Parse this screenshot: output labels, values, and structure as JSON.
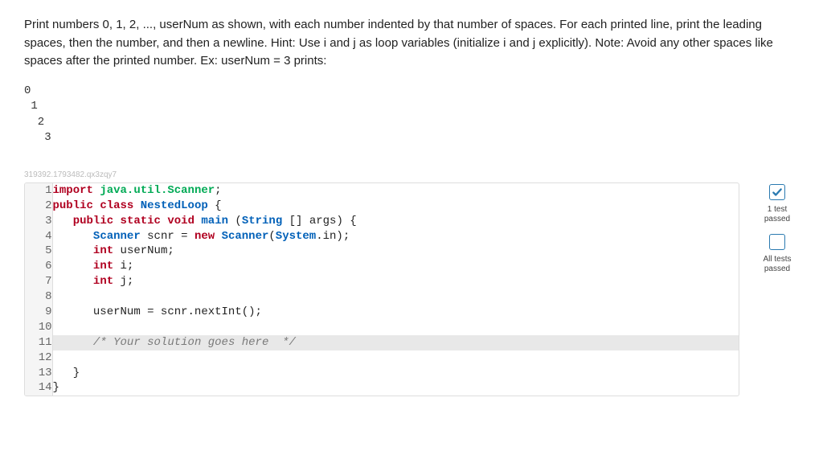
{
  "problem": {
    "description": "Print numbers 0, 1, 2, ..., userNum as shown, with each number indented by that number of spaces. For each printed line, print the leading spaces, then the number, and then a newline. Hint: Use i and j as loop variables (initialize i and j explicitly). Note: Avoid any other spaces like spaces after the printed number. Ex: userNum = 3 prints:",
    "example_output": "0\n 1\n  2\n   3"
  },
  "tracking_id": "319392.1793482.qx3zqy7",
  "code": {
    "lines": [
      {
        "n": "1",
        "segs": [
          {
            "c": "kw-import",
            "t": "import"
          },
          {
            "c": "plain",
            "t": " "
          },
          {
            "c": "kw-pkg",
            "t": "java.util.Scanner"
          },
          {
            "c": "plain",
            "t": ";"
          }
        ]
      },
      {
        "n": "2",
        "segs": [
          {
            "c": "kw-mod",
            "t": "public"
          },
          {
            "c": "plain",
            "t": " "
          },
          {
            "c": "kw-cls",
            "t": "class"
          },
          {
            "c": "plain",
            "t": " "
          },
          {
            "c": "cls-name",
            "t": "NestedLoop"
          },
          {
            "c": "plain",
            "t": " {"
          }
        ]
      },
      {
        "n": "3",
        "segs": [
          {
            "c": "plain",
            "t": "   "
          },
          {
            "c": "kw-mod",
            "t": "public"
          },
          {
            "c": "plain",
            "t": " "
          },
          {
            "c": "kw-mod",
            "t": "static"
          },
          {
            "c": "plain",
            "t": " "
          },
          {
            "c": "kw-type",
            "t": "void"
          },
          {
            "c": "plain",
            "t": " "
          },
          {
            "c": "method",
            "t": "main"
          },
          {
            "c": "plain",
            "t": " ("
          },
          {
            "c": "type-ref",
            "t": "String"
          },
          {
            "c": "plain",
            "t": " [] args) {"
          }
        ]
      },
      {
        "n": "4",
        "segs": [
          {
            "c": "plain",
            "t": "      "
          },
          {
            "c": "type-ref",
            "t": "Scanner"
          },
          {
            "c": "plain",
            "t": " scnr = "
          },
          {
            "c": "kw-new",
            "t": "new"
          },
          {
            "c": "plain",
            "t": " "
          },
          {
            "c": "type-ref",
            "t": "Scanner"
          },
          {
            "c": "plain",
            "t": "("
          },
          {
            "c": "type-ref",
            "t": "System"
          },
          {
            "c": "plain",
            "t": ".in);"
          }
        ]
      },
      {
        "n": "5",
        "segs": [
          {
            "c": "plain",
            "t": "      "
          },
          {
            "c": "kw-type",
            "t": "int"
          },
          {
            "c": "plain",
            "t": " userNum;"
          }
        ]
      },
      {
        "n": "6",
        "segs": [
          {
            "c": "plain",
            "t": "      "
          },
          {
            "c": "kw-type",
            "t": "int"
          },
          {
            "c": "plain",
            "t": " i;"
          }
        ]
      },
      {
        "n": "7",
        "segs": [
          {
            "c": "plain",
            "t": "      "
          },
          {
            "c": "kw-type",
            "t": "int"
          },
          {
            "c": "plain",
            "t": " j;"
          }
        ]
      },
      {
        "n": "8",
        "segs": [
          {
            "c": "plain",
            "t": ""
          }
        ]
      },
      {
        "n": "9",
        "segs": [
          {
            "c": "plain",
            "t": "      userNum = scnr.nextInt();"
          }
        ]
      },
      {
        "n": "10",
        "segs": [
          {
            "c": "plain",
            "t": ""
          }
        ]
      },
      {
        "n": "11",
        "hl": true,
        "segs": [
          {
            "c": "plain",
            "t": "      "
          },
          {
            "c": "comment",
            "t": "/* Your solution goes here  */"
          }
        ]
      },
      {
        "n": "12",
        "segs": [
          {
            "c": "plain",
            "t": ""
          }
        ]
      },
      {
        "n": "13",
        "segs": [
          {
            "c": "plain",
            "t": "   }"
          }
        ]
      },
      {
        "n": "14",
        "segs": [
          {
            "c": "plain",
            "t": "}"
          }
        ]
      }
    ]
  },
  "sidebar": {
    "status1": {
      "label": "1 test\npassed"
    },
    "status2": {
      "label": "All tests\npassed"
    }
  }
}
